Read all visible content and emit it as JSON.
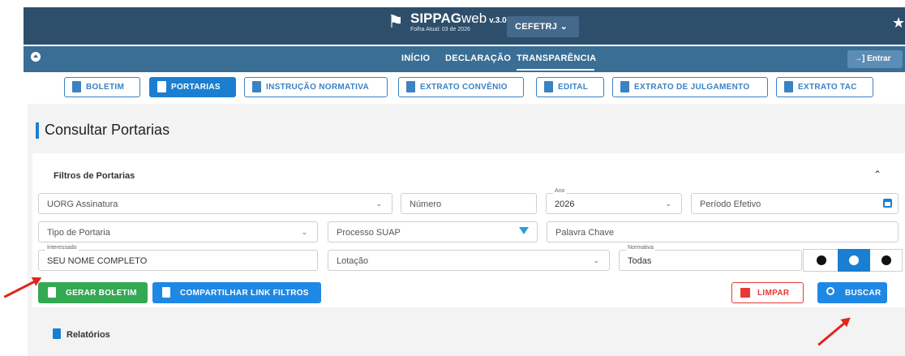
{
  "header": {
    "brand": "SIPPAG",
    "brand_suffix": "web",
    "version": "v.3.0",
    "subtitle": "Folha Atual: 03 de 2026",
    "institution": "CEFETRJ",
    "accessibility_icon": "accessibility-icon"
  },
  "nav": {
    "items": [
      "INÍCIO",
      "DECLARAÇÃO",
      "TRANSPARÊNCIA"
    ],
    "active": "TRANSPARÊNCIA",
    "login_label": "Entrar"
  },
  "tabs": [
    {
      "label": "BOLETIM",
      "icon": "file-icon"
    },
    {
      "label": "PORTARIAS",
      "icon": "file-icon",
      "active": true
    },
    {
      "label": "INSTRUÇÃO NORMATIVA",
      "icon": "book-icon"
    },
    {
      "label": "EXTRATO CONVÊNIO",
      "icon": "list-icon"
    },
    {
      "label": "EDITAL",
      "icon": "file-icon"
    },
    {
      "label": "EXTRATO DE JULGAMENTO",
      "icon": "file-icon"
    },
    {
      "label": "EXTRATO TAC",
      "icon": "sign-icon"
    }
  ],
  "page": {
    "title": "Consultar Portarias"
  },
  "filters": {
    "title": "Filtros de Portarias",
    "uorg": "UORG Assinatura",
    "numero": "Número",
    "ano_label": "Ano",
    "ano_value": "2026",
    "periodo": "Período Efetivo",
    "tipo": "Tipo de Portaria",
    "processo": "Processo SUAP",
    "palavra": "Palavra Chave",
    "interessado_label": "Interessado",
    "interessado_value": "SEU NOME COMPLETO",
    "lotacao": "Lotação",
    "normativa_label": "Normativa",
    "normativa_value": "Todas",
    "normativa_toggle_selected": 1
  },
  "actions": {
    "gerar": "GERAR BOLETIM",
    "compartilhar": "COMPARTILHAR LINK FILTROS",
    "limpar": "LIMPAR",
    "buscar": "BUSCAR"
  },
  "relatorios": {
    "title": "Relatórios"
  },
  "colors": {
    "header_dark": "#2e4f6b",
    "nav_blue": "#3a6e95",
    "primary": "#1a7fd1",
    "green": "#34a853",
    "danger": "#e53935",
    "arrow": "#e0231c"
  }
}
